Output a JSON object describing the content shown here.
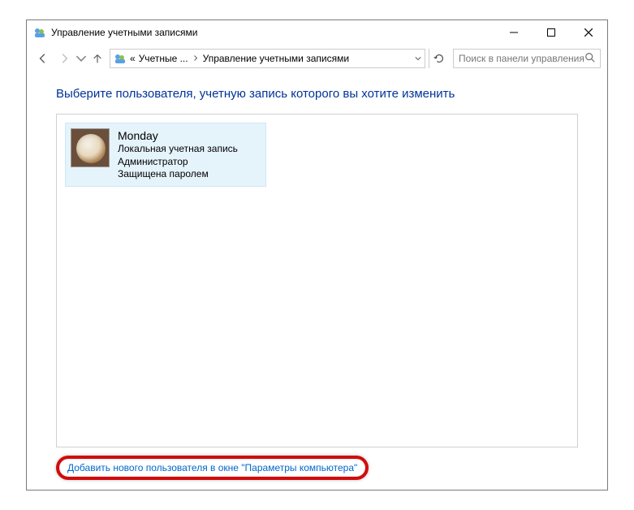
{
  "window": {
    "title": "Управление учетными записями"
  },
  "breadcrumb": {
    "prefix": "«",
    "seg1": "Учетные ...",
    "seg2": "Управление учетными записями"
  },
  "search": {
    "placeholder": "Поиск в панели управления"
  },
  "heading": "Выберите пользователя, учетную запись которого вы хотите изменить",
  "user": {
    "name": "Monday",
    "type": "Локальная учетная запись",
    "role": "Администратор",
    "protection": "Защищена паролем"
  },
  "add_link": "Добавить нового пользователя в окне \"Параметры компьютера\""
}
